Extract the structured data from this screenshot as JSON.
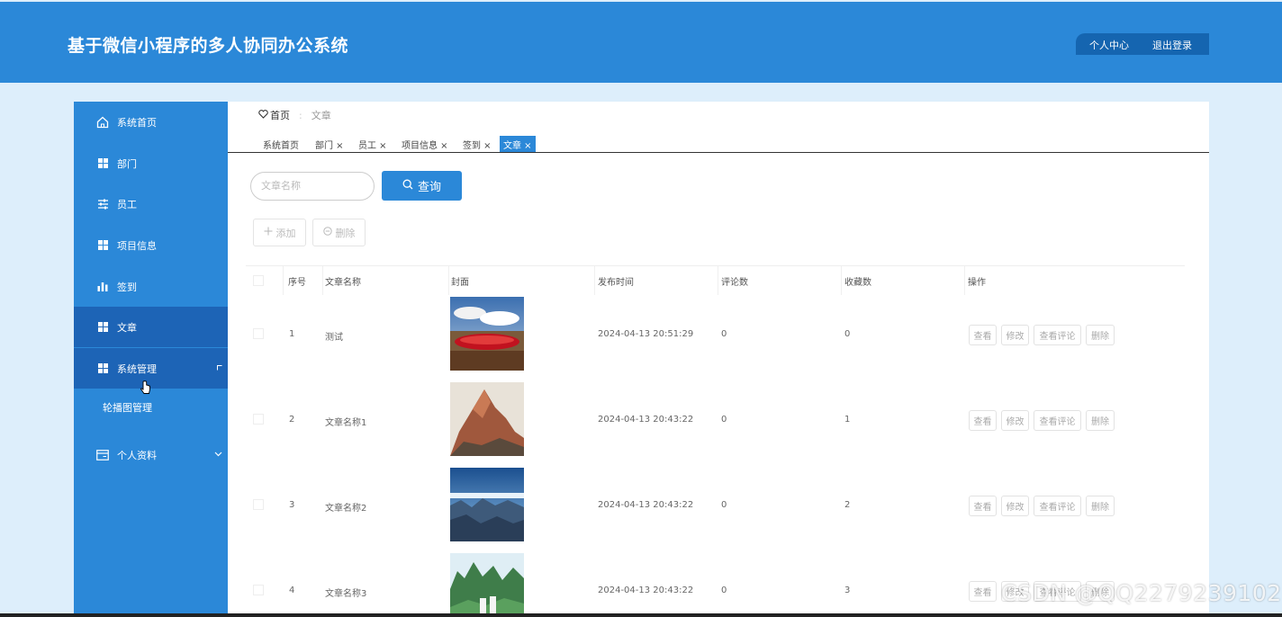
{
  "header": {
    "title": "基于微信小程序的多人协同办公系统",
    "personal_center": "个人中心",
    "logout": "退出登录"
  },
  "sidebar": {
    "items": [
      {
        "label": "系统首页",
        "icon": "home-icon"
      },
      {
        "label": "部门",
        "icon": "grid-icon"
      },
      {
        "label": "员工",
        "icon": "sliders-icon"
      },
      {
        "label": "项目信息",
        "icon": "grid-icon"
      },
      {
        "label": "签到",
        "icon": "bar-chart-icon"
      },
      {
        "label": "文章",
        "icon": "grid-icon"
      },
      {
        "label": "系统管理",
        "icon": "grid-icon"
      }
    ],
    "sub_items": [
      {
        "label": "轮播图管理"
      }
    ],
    "profile": {
      "label": "个人资料",
      "icon": "card-icon"
    }
  },
  "breadcrumb": {
    "home": "首页",
    "current": "文章"
  },
  "tabs": [
    {
      "label": "系统首页"
    },
    {
      "label": "部门 ×"
    },
    {
      "label": "员工 ×"
    },
    {
      "label": "项目信息 ×"
    },
    {
      "label": "签到 ×"
    },
    {
      "label": "文章 ×"
    }
  ],
  "search": {
    "placeholder": "文章名称",
    "button": "查询"
  },
  "actions": {
    "add": "添加",
    "delete": "删除"
  },
  "table": {
    "columns": [
      "序号",
      "文章名称",
      "封面",
      "发布时间",
      "评论数",
      "收藏数",
      "操作"
    ],
    "rows": [
      {
        "index": "1",
        "name": "测试",
        "time": "2024-04-13 20:51:29",
        "comments": "0",
        "favorites": "0"
      },
      {
        "index": "2",
        "name": "文章名称1",
        "time": "2024-04-13 20:43:22",
        "comments": "0",
        "favorites": "1"
      },
      {
        "index": "3",
        "name": "文章名称2",
        "time": "2024-04-13 20:43:22",
        "comments": "0",
        "favorites": "2"
      },
      {
        "index": "4",
        "name": "文章名称3",
        "time": "2024-04-13 20:43:22",
        "comments": "0",
        "favorites": "3"
      }
    ],
    "row_buttons": {
      "view": "查看",
      "edit": "修改",
      "view_comments": "查看评论",
      "delete": "删除"
    }
  },
  "watermark": "CSDN @QQ2279239102",
  "colors": {
    "primary": "#2b88d8",
    "sidebar_active": "#1d64b6",
    "page_bg": "#ddeefb"
  }
}
